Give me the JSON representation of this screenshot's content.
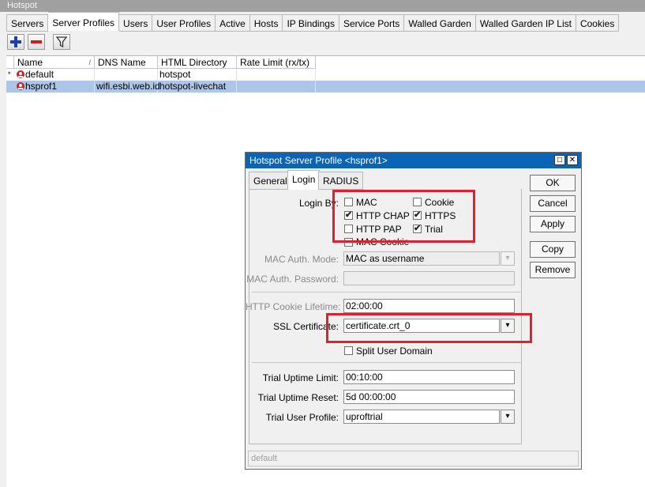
{
  "window": {
    "title": "Hotspot"
  },
  "tabs": [
    "Servers",
    "Server Profiles",
    "Users",
    "User Profiles",
    "Active",
    "Hosts",
    "IP Bindings",
    "Service Ports",
    "Walled Garden",
    "Walled Garden IP List",
    "Cookies"
  ],
  "toolbar": {
    "icons": [
      "plus-icon",
      "minus-icon",
      "filter-icon"
    ]
  },
  "table": {
    "headers": [
      "Name",
      "DNS Name",
      "HTML Directory",
      "Rate Limit (rx/tx)"
    ],
    "rows": [
      {
        "marker": "*",
        "name": "default",
        "dns": "",
        "dir": "hotspot",
        "rate": ""
      },
      {
        "marker": "",
        "name": "hsprof1",
        "dns": "wifi.esbi.web.id",
        "dir": "hotspot-livechat",
        "rate": ""
      }
    ]
  },
  "dialog": {
    "title": "Hotspot Server Profile <hsprof1>",
    "tabs": [
      "General",
      "Login",
      "RADIUS"
    ],
    "login_by_label": "Login By:",
    "checkboxes": {
      "mac": {
        "label": "MAC",
        "checked": false
      },
      "cookie": {
        "label": "Cookie",
        "checked": false
      },
      "http_chap": {
        "label": "HTTP CHAP",
        "checked": true
      },
      "https": {
        "label": "HTTPS",
        "checked": true
      },
      "http_pap": {
        "label": "HTTP PAP",
        "checked": false
      },
      "trial": {
        "label": "Trial",
        "checked": true
      },
      "mac_cookie": {
        "label": "MAC Cookie",
        "checked": false
      }
    },
    "mac_auth_mode": {
      "label": "MAC Auth. Mode:",
      "value": "MAC as username"
    },
    "mac_auth_password": {
      "label": "MAC Auth. Password:",
      "value": ""
    },
    "http_cookie_lifetime": {
      "label": "HTTP Cookie Lifetime:",
      "value": "02:00:00"
    },
    "ssl_certificate": {
      "label": "SSL Certificate:",
      "value": "certificate.crt_0"
    },
    "split_user_domain": {
      "label": "Split User Domain",
      "checked": false
    },
    "trial_uptime_limit": {
      "label": "Trial Uptime Limit:",
      "value": "00:10:00"
    },
    "trial_uptime_reset": {
      "label": "Trial Uptime Reset:",
      "value": "5d 00:00:00"
    },
    "trial_user_profile": {
      "label": "Trial User Profile:",
      "value": "uproftrial"
    },
    "buttons": {
      "ok": "OK",
      "cancel": "Cancel",
      "apply": "Apply",
      "copy": "Copy",
      "remove": "Remove"
    },
    "status": "default"
  },
  "colors": {
    "dialog_title_bg": "#0b64b6",
    "selection": "#adc6e8",
    "highlight_box": "#e0202c"
  }
}
